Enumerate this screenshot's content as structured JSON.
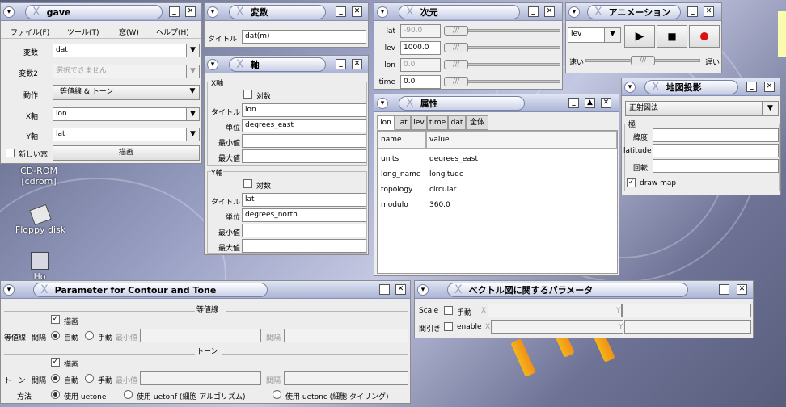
{
  "desktop": {
    "icons": [
      {
        "label1": "CD-ROM",
        "label2": "[cdrom]"
      },
      {
        "label1": "Floppy disk"
      },
      {
        "label1": "Ho"
      }
    ]
  },
  "gave": {
    "title": "gave",
    "menus": [
      "ファイル(F)",
      "ツール(T)",
      "窓(W)",
      "ヘルプ(H)"
    ],
    "rows": [
      {
        "label": "変数",
        "value": "dat"
      },
      {
        "label": "変数2",
        "value": "選択できません"
      },
      {
        "label": "動作",
        "value": "等値線 & トーン"
      },
      {
        "label": "X軸",
        "value": "lon"
      },
      {
        "label": "Y軸",
        "value": "lat"
      }
    ],
    "new_window": "新しい窓",
    "draw": "描画"
  },
  "var": {
    "title": "変数",
    "label": "タイトル",
    "value": "dat(m)"
  },
  "axis": {
    "title": "軸",
    "x": {
      "section": "X軸",
      "log": "対数",
      "rows": [
        {
          "label": "タイトル",
          "value": "lon"
        },
        {
          "label": "単位",
          "value": "degrees_east"
        },
        {
          "label": "最小値",
          "value": ""
        },
        {
          "label": "最大値",
          "value": ""
        }
      ]
    },
    "y": {
      "section": "Y軸",
      "log": "対数",
      "rows": [
        {
          "label": "タイトル",
          "value": "lat"
        },
        {
          "label": "単位",
          "value": "degrees_north"
        },
        {
          "label": "最小値",
          "value": ""
        },
        {
          "label": "最大値",
          "value": ""
        }
      ]
    }
  },
  "dim": {
    "title": "次元",
    "rows": [
      {
        "label": "lat",
        "value": "-90.0",
        "disabled": true
      },
      {
        "label": "lev",
        "value": "1000.0",
        "disabled": false
      },
      {
        "label": "lon",
        "value": "0.0",
        "disabled": true
      },
      {
        "label": "time",
        "value": "0.0",
        "disabled": false
      }
    ]
  },
  "anim": {
    "title": "アニメーション",
    "select": "lev",
    "slow": "速い",
    "fast": "遅い",
    "accent": "#dd1111"
  },
  "proj": {
    "title": "地図投影",
    "select": "正射図法",
    "section": "極",
    "rows": [
      {
        "label": "緯度",
        "value": ""
      },
      {
        "label": "latitude",
        "value": ""
      },
      {
        "label": "回転",
        "value": ""
      }
    ],
    "drawmap": "draw map"
  },
  "attr": {
    "title": "属性",
    "tabs": [
      "lon",
      "lat",
      "lev",
      "time",
      "dat",
      "全体"
    ],
    "headers": [
      "name",
      "value"
    ],
    "rows": [
      [
        "units",
        "degrees_east"
      ],
      [
        "long_name",
        "longitude"
      ],
      [
        "topology",
        "circular"
      ],
      [
        "modulo",
        "360.0"
      ]
    ]
  },
  "contour": {
    "title": "Parameter for Contour and Tone",
    "contour_head": "等値線",
    "tone_head": "トーン",
    "draw": "描画",
    "line_label": "等値線",
    "tone_label": "トーン",
    "interval": "間隔",
    "auto": "自動",
    "manual": "手動",
    "min": "最小値",
    "gap": "間隔",
    "method": "方法",
    "m1": "使用 uetone",
    "m2": "使用 uetonf (細胞 アルゴリズム)",
    "m3": "使用 uetonc (細胞 タイリング)"
  },
  "vector": {
    "title": "ベクトル図に関するパラメータ",
    "scale": "Scale",
    "manual": "手動",
    "thin": "間引き",
    "enable": "enable",
    "x": "X",
    "y": "Y"
  }
}
